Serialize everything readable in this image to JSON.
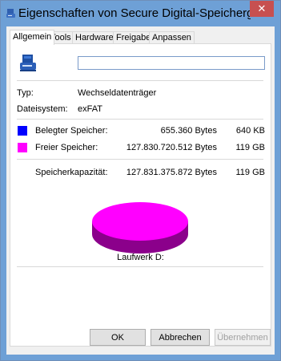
{
  "window": {
    "title": "Eigenschaften von Secure Digital-Speicherg...",
    "close_glyph": "✕"
  },
  "tabs": [
    {
      "label": "Allgemein",
      "active": true
    },
    {
      "label": "Tools",
      "active": false
    },
    {
      "label": "Hardware",
      "active": false
    },
    {
      "label": "Freigabe",
      "active": false
    },
    {
      "label": "Anpassen",
      "active": false
    }
  ],
  "general": {
    "drive_name_value": "",
    "type_label": "Typ:",
    "type_value": "Wechseldatenträger",
    "fs_label": "Dateisystem:",
    "fs_value": "exFAT",
    "used_label": "Belegter Speicher:",
    "used_bytes": "655.360 Bytes",
    "used_short": "640 KB",
    "used_color": "#0000ff",
    "free_label": "Freier Speicher:",
    "free_bytes": "127.830.720.512 Bytes",
    "free_short": "119 GB",
    "free_color": "#ff00ff",
    "capacity_label": "Speicherkapazität:",
    "capacity_bytes": "127.831.375.872 Bytes",
    "capacity_short": "119 GB",
    "drive_label": "Laufwerk D:"
  },
  "buttons": {
    "ok": "OK",
    "cancel": "Abbrechen",
    "apply": "Übernehmen"
  }
}
